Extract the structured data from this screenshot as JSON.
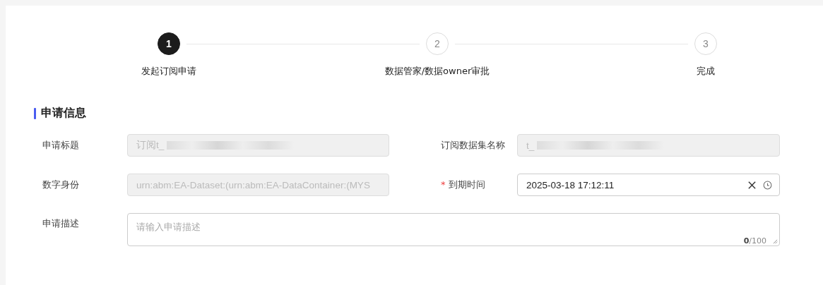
{
  "steps": [
    {
      "number": "1",
      "label": "发起订阅申请",
      "selected": true
    },
    {
      "number": "2",
      "label": "数据管家/数据owner审批",
      "selected": false
    },
    {
      "number": "3",
      "label": "完成",
      "selected": false
    }
  ],
  "section_title": "申请信息",
  "rows": [
    [
      {
        "label": "申请标题",
        "kind": "text",
        "disabled": true,
        "value": "订阅t_",
        "redacted": true
      },
      {
        "label": "订阅数据集名称",
        "kind": "text",
        "disabled": true,
        "value": "t_",
        "redacted": true
      }
    ],
    [
      {
        "label": "数字身份",
        "kind": "text",
        "disabled": true,
        "value": "urn:abm:EA-Dataset:(urn:abm:EA-DataContainer:(MYS",
        "redacted": false
      },
      {
        "label": "到期时间",
        "kind": "datetime",
        "required_mark": "*",
        "disabled": false,
        "value": "2025-03-18 17:12:11",
        "redacted": false
      }
    ]
  ],
  "description": {
    "label": "申请描述",
    "placeholder": "请输入申请描述",
    "count": "0",
    "max": "/100"
  }
}
